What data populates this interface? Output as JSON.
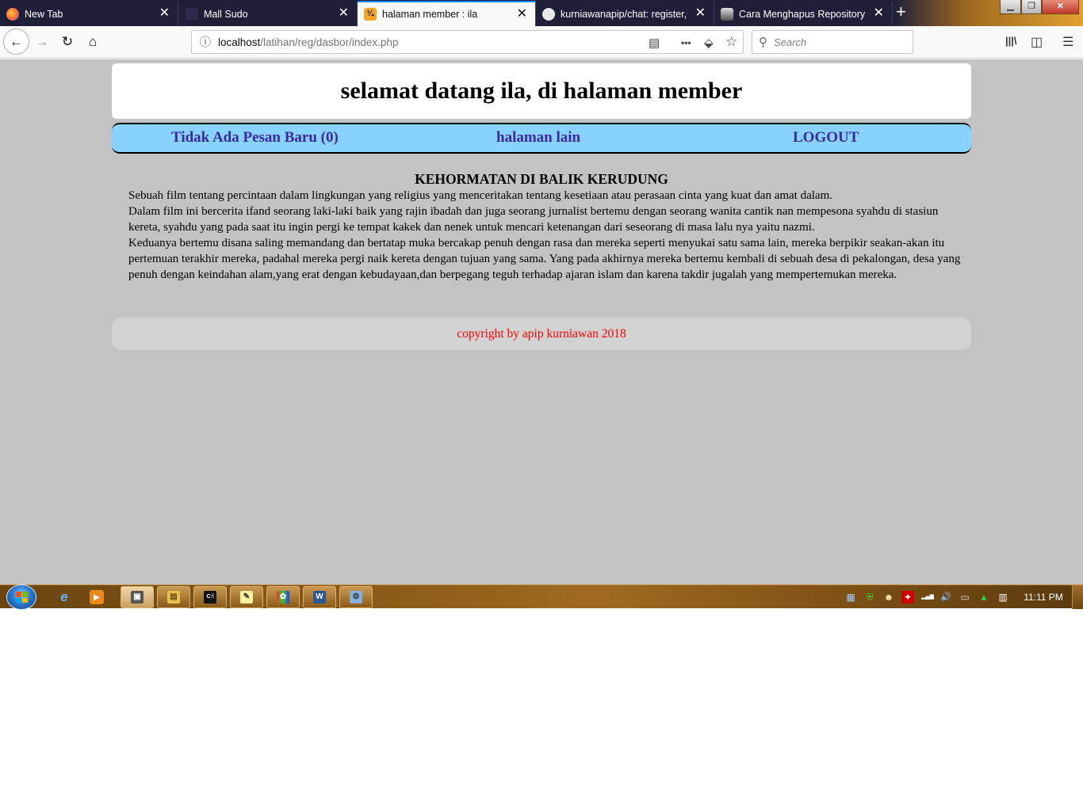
{
  "browser": {
    "tabs": [
      {
        "label": "New Tab",
        "icon": "firefox-icon",
        "active": false
      },
      {
        "label": "Mall Sudo",
        "icon": "mall-sudo-favicon",
        "active": false
      },
      {
        "label": "halaman member : ila",
        "icon": "xampp-favicon",
        "active": true
      },
      {
        "label": "kurniawanapip/chat: register,lo",
        "icon": "github-icon",
        "active": false
      },
      {
        "label": "Cara Menghapus Repository Di",
        "icon": "avatar-favicon",
        "active": false
      }
    ],
    "tab_close_glyph": "✕",
    "new_tab_glyph": "+",
    "window_controls": {
      "minimize": "▁",
      "maximize": "❐",
      "close": "✕"
    },
    "url": {
      "host": "localhost",
      "path": "/latihan/reg/dasbor/index.php"
    },
    "search_placeholder": "Search",
    "nav_glyphs": {
      "back": "←",
      "forward": "→",
      "reload": "↻",
      "home": "⌂"
    },
    "url_glyphs": {
      "info": "ⓘ",
      "reader": "▤",
      "more": "•••",
      "pocket": "⬙",
      "bookmark": "☆"
    },
    "toolbar_glyphs": {
      "library": "|||\\",
      "sidebar": "◫",
      "menu": "☰",
      "search": "⚲"
    }
  },
  "page": {
    "header_title": "selamat datang ila, di halaman member",
    "menu": {
      "messages": "Tidak Ada Pesan Baru (0)",
      "other_page": "halaman lain",
      "logout": "LOGOUT"
    },
    "article": {
      "title": "KEHORMATAN DI BALIK KERUDUNG",
      "paragraphs": [
        "Sebuah film tentang percintaan dalam lingkungan yang religius yang menceritakan tentang kesetiaan atau perasaan cinta yang kuat dan amat dalam.",
        "Dalam film ini bercerita ifand seorang laki-laki baik yang rajin ibadah dan juga seorang jurnalist bertemu dengan seorang wanita cantik nan mempesona syahdu di stasiun kereta, syahdu yang pada saat itu ingin pergi ke tempat kakek dan nenek untuk mencari ketenangan dari seseorang di masa lalu nya yaitu nazmi.",
        "Keduanya bertemu disana saling memandang dan bertatap muka bercakap penuh dengan rasa dan mereka seperti menyukai satu sama lain, mereka berpikir seakan-akan itu pertemuan terakhir mereka, padahal mereka pergi naik kereta dengan tujuan yang sama. Yang pada akhirnya mereka bertemu kembali di sebuah desa di pekalongan, desa yang penuh dengan keindahan alam,yang erat dengan kebudayaan,dan berpegang teguh terhadap ajaran islam dan karena takdir jugalah yang mempertemukan mereka."
      ]
    },
    "footer": "copyright by apip kurniawan 2018"
  },
  "taskbar": {
    "pinned": [
      {
        "icon": "internet-explorer-icon",
        "glyph": "e"
      },
      {
        "icon": "media-player-icon",
        "glyph": "▶"
      }
    ],
    "apps": [
      {
        "icon": "firefox-app-icon",
        "glyph": "▣"
      },
      {
        "icon": "file-explorer-icon",
        "glyph": "▤"
      },
      {
        "icon": "command-prompt-icon",
        "glyph": "C:\\"
      },
      {
        "icon": "notepad-icon",
        "glyph": "✎"
      },
      {
        "icon": "paint-icon",
        "glyph": "✿"
      },
      {
        "icon": "word-icon",
        "glyph": "W"
      },
      {
        "icon": "control-panel-icon",
        "glyph": "⚙"
      }
    ],
    "tray": [
      {
        "icon": "network-share-icon",
        "glyph": "▦"
      },
      {
        "icon": "security-shield-icon",
        "glyph": "⛨"
      },
      {
        "icon": "messenger-icon",
        "glyph": "☻"
      },
      {
        "icon": "acrobat-icon",
        "glyph": "✦"
      },
      {
        "icon": "signal-strength-icon",
        "glyph": "▂▄▆"
      },
      {
        "icon": "volume-icon",
        "glyph": "🔊"
      },
      {
        "icon": "display-icon",
        "glyph": "▭"
      },
      {
        "icon": "drive-icon",
        "glyph": "▲"
      },
      {
        "icon": "usb-device-icon",
        "glyph": "▥"
      }
    ],
    "clock": "11:11 PM"
  },
  "colors": {
    "page_background": "#c3c3c3",
    "menu_background": "#87d2ff",
    "menu_link": "#3b2aa0",
    "footer_text": "#ff0000",
    "active_tab_accent": "#0a84ff"
  }
}
